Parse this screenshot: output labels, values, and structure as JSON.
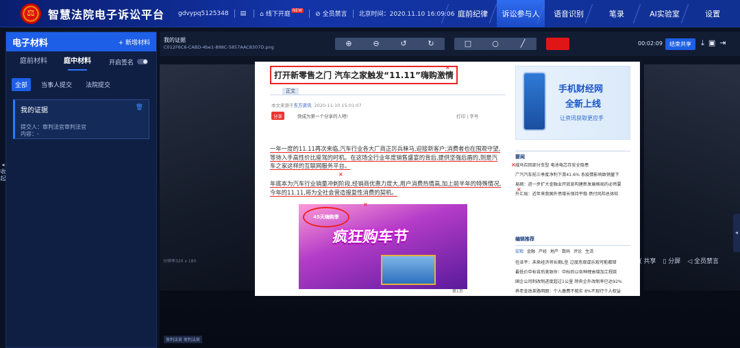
{
  "app": {
    "title": "智慧法院电子诉讼平台",
    "logo_glyph": "⚖"
  },
  "meta": {
    "user": "gdvypq5125348",
    "offline_open": "线下开庭",
    "new_badge": "NEW",
    "mute_all": "全员禁言",
    "beijing_time": "北京时间：2020.11.10 16:09:06"
  },
  "nav": {
    "tabs": [
      "庭前纪律",
      "诉讼参与人",
      "语音识别",
      "笔录",
      "AI实验室",
      "设置"
    ],
    "active_index": 1
  },
  "sidebar": {
    "title": "电子材料",
    "add": "+ 新增材料",
    "tabs": [
      "庭前材料",
      "庭中材料"
    ],
    "active_tab": 1,
    "sign_label": "开启签名",
    "filters": [
      "全部",
      "当事人提交",
      "法院提交"
    ],
    "active_filter": 0,
    "card": {
      "title": "我的证据",
      "submitter": "提交人：审判法官审判法官",
      "content": "内容：-"
    },
    "collapse": "收起"
  },
  "main": {
    "evidence_title": "我的证据",
    "evidence_file": "C012F6C6-CABD-4be1-898C-5857AAC8307D.png",
    "tools": {
      "zoom_in": "⊕",
      "zoom_out": "⊖",
      "rotate_left": "↺",
      "rotate_right": "↻",
      "rect": "□",
      "circle": "○",
      "line": "╱"
    },
    "timer": "00:02:09",
    "end_share": "结束共享",
    "resolution": "分辨率320 x 180",
    "right_controls": {
      "share": "共享",
      "split": "分屏",
      "mute": "全员禁言"
    },
    "bottom_label": "审判法官 审判法官"
  },
  "document": {
    "headline": "打开新零售之门 汽车之家触发“11.11”嗨购激情",
    "tab_zhengwen": "正文",
    "source": "本文来源于",
    "source_name": "东方资讯",
    "source_time": "2020-11-10 15:01:07",
    "share_btn": "分享",
    "share_text": "快成为第一个分享的人吧!",
    "print": "打印 | 字号",
    "para1": "一年一度的11.11再次来临,汽车行业各大厂商正厉兵秣马,迎接新客户;消费者也在围观守望,等待入手高性价比座驾的时机。在这场全行业年度销售盛宴的背后,提供坚强后盾的,则是汽车之家这样的互联网服务平台。",
    "para2": "年底本为汽车行业销量冲刺阶段,经销商优惠力度大,用户消费热情高,加上前半年的特殊情况,今年的11.11,将为全社会营造报复性消费的契机。",
    "promo_text": "疯狂购车节",
    "promo_tag": "45天嗨购季",
    "page_num": "第1页",
    "ad": {
      "line1": "手机财经网",
      "line2": "全新上线",
      "line3": "让资讯获取更应手"
    },
    "hot_title": "要闻",
    "hot_news": [
      "威马召回部分车型 电池电芯存安全隐患",
      "广汽汽车前三季度净利下滑41.6% 系疫情影响致销量下",
      "易纲：进一步扩大金融业开放息构建新发展格局的必然要",
      "外汇局：近年来我国外债增长保持平稳 债付风险总体较"
    ],
    "edit_title": "编辑推荐",
    "mini_tabs": [
      "宏观",
      "金融",
      "产经",
      "地产",
      "数码",
      "评论",
      "生活"
    ],
    "edit_news": [
      "任泽平：未来经济将长期L型 过度悲观或乐观可能都错",
      "最低价中标背后美致命：中标后以各种理由增加工程款",
      "国企公司制改制进度超过1公里 除央企外改制率已达92%",
      "养老金改革路明朗：个人缴费不能实 8%不现行个人权益"
    ]
  },
  "colors": {
    "accent": "#1d5fe6",
    "annotation_red": "#e22222",
    "topbar": "#1334a8"
  }
}
